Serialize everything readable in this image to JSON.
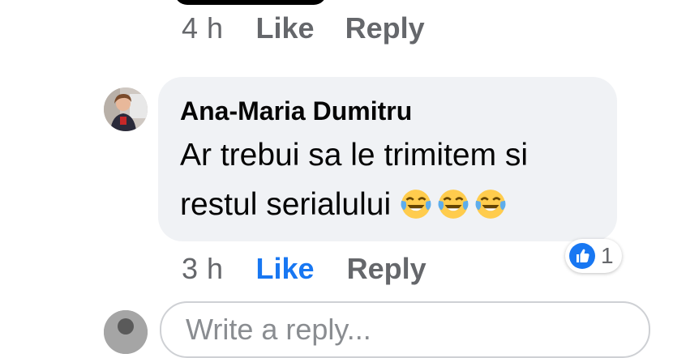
{
  "previous_comment": {
    "time": "4 h",
    "like_label": "Like",
    "reply_label": "Reply"
  },
  "comment": {
    "author": "Ana-Maria Dumitru",
    "text_lines": [
      "Ar trebui sa le trimitem si",
      "restul serialului"
    ],
    "emojis": [
      "face-with-tears-of-joy-icon",
      "face-with-tears-of-joy-icon",
      "face-with-tears-of-joy-icon"
    ],
    "time": "3 h",
    "like_label": "Like",
    "reply_label": "Reply",
    "liked": true,
    "reaction_count": "1"
  },
  "reply_box": {
    "placeholder": "Write a reply..."
  },
  "colors": {
    "secondary_text": "#65676b",
    "like_active": "#1877f2",
    "bubble_bg": "#f0f2f5"
  }
}
